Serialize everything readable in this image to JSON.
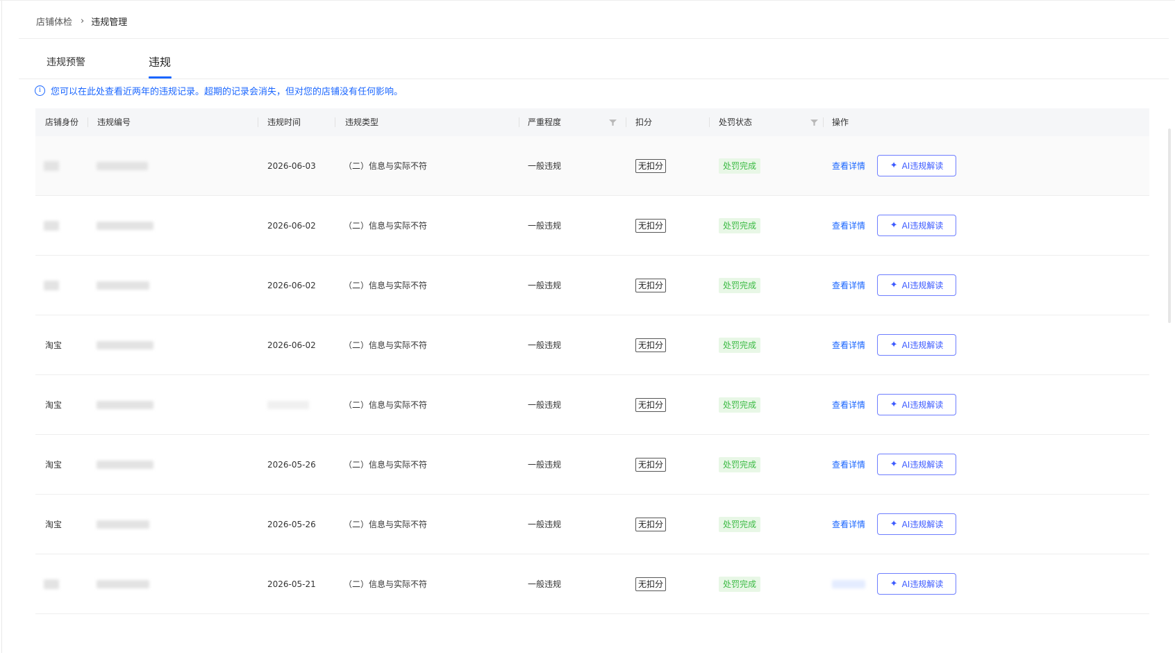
{
  "breadcrumb": {
    "parent": "店铺体检",
    "separator": "›",
    "current": "违规管理"
  },
  "tabs": [
    {
      "label": "违规预警",
      "active": false
    },
    {
      "label": "违规",
      "active": true
    }
  ],
  "notice": {
    "icon": "info-icon",
    "text": "您可以在此处查看近两年的违规记录。超期的记录会消失，但对您的店铺没有任何影响。"
  },
  "table": {
    "columns": [
      "店铺身份",
      "违规编号",
      "违规时间",
      "违规类型",
      "严重程度",
      "扣分",
      "处罚状态",
      "操作"
    ],
    "filterable": [
      "严重程度",
      "处罚状态"
    ],
    "rows": [
      {
        "identity": "",
        "violation_id": "",
        "date": "2026-06-03",
        "type": "（二）信息与实际不符",
        "severity": "一般违规",
        "score": "无扣分",
        "status": "处罚完成",
        "detail": "查看详情",
        "ai": "AI违规解读"
      },
      {
        "identity": "",
        "violation_id": "",
        "date": "2026-06-02",
        "type": "（二）信息与实际不符",
        "severity": "一般违规",
        "score": "无扣分",
        "status": "处罚完成",
        "detail": "查看详情",
        "ai": "AI违规解读"
      },
      {
        "identity": "",
        "violation_id": "",
        "date": "2026-06-02",
        "type": "（二）信息与实际不符",
        "severity": "一般违规",
        "score": "无扣分",
        "status": "处罚完成",
        "detail": "查看详情",
        "ai": "AI违规解读"
      },
      {
        "identity": "淘宝",
        "violation_id": "",
        "date": "2026-06-02",
        "type": "（二）信息与实际不符",
        "severity": "一般违规",
        "score": "无扣分",
        "status": "处罚完成",
        "detail": "查看详情",
        "ai": "AI违规解读"
      },
      {
        "identity": "淘宝",
        "violation_id": "",
        "date": "",
        "type": "（二）信息与实际不符",
        "severity": "一般违规",
        "score": "无扣分",
        "status": "处罚完成",
        "detail": "查看详情",
        "ai": "AI违规解读"
      },
      {
        "identity": "淘宝",
        "violation_id": "",
        "date": "2026-05-26",
        "type": "（二）信息与实际不符",
        "severity": "一般违规",
        "score": "无扣分",
        "status": "处罚完成",
        "detail": "查看详情",
        "ai": "AI违规解读"
      },
      {
        "identity": "淘宝",
        "violation_id": "",
        "date": "2026-05-26",
        "type": "（二）信息与实际不符",
        "severity": "一般违规",
        "score": "无扣分",
        "status": "处罚完成",
        "detail": "查看详情",
        "ai": "AI违规解读"
      },
      {
        "identity": "",
        "violation_id": "",
        "date": "2026-05-21",
        "type": "（二）信息与实际不符",
        "severity": "一般违规",
        "score": "无扣分",
        "status": "处罚完成",
        "detail": "",
        "ai": "AI违规解读"
      }
    ]
  },
  "colors": {
    "accent": "#1a66ff",
    "status_green": "#3dbb45",
    "ai_border": "#6d7dff"
  },
  "icons": {
    "filter": "filter-icon",
    "ai": "sparkle-icon",
    "separator": "chevron-right-icon"
  }
}
